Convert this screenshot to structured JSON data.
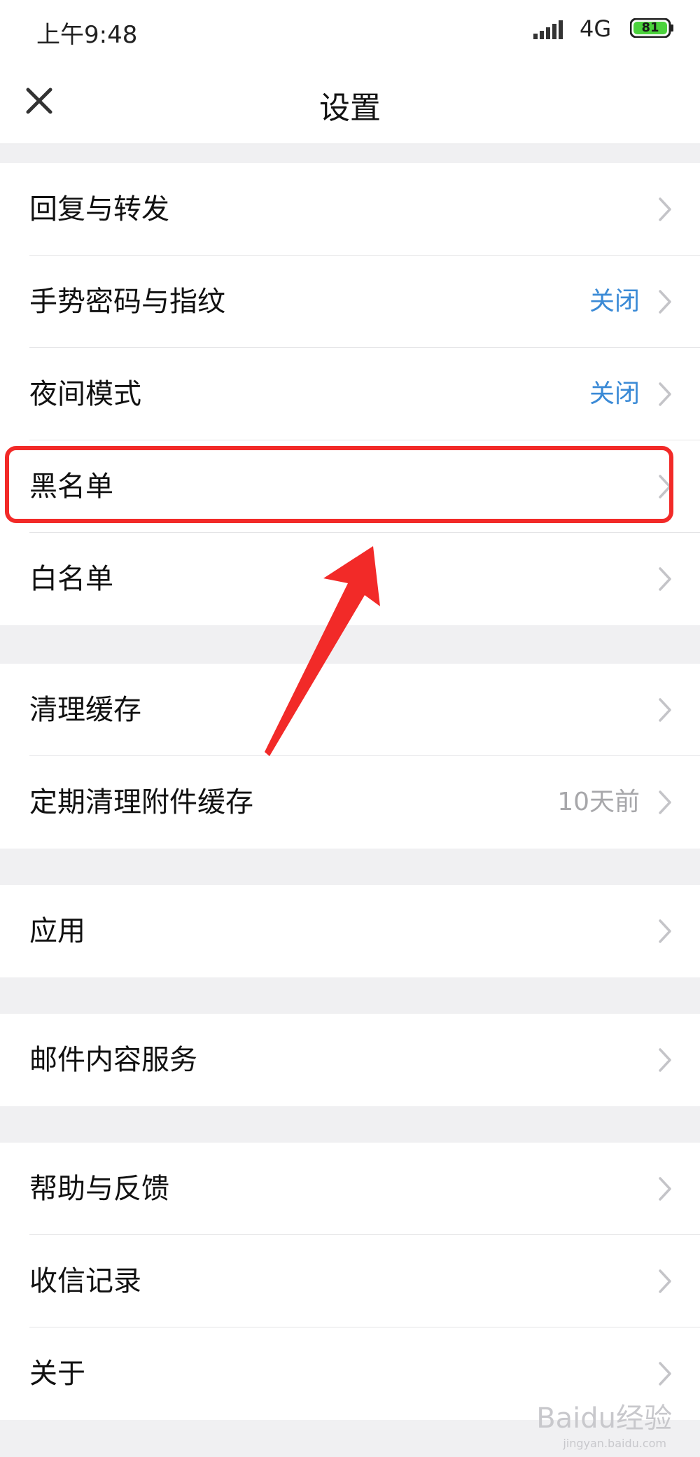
{
  "status_bar": {
    "time": "上午9:48",
    "network": "4G",
    "battery": "81",
    "signal_icon": "signal-bars-icon",
    "battery_icon": "battery-icon"
  },
  "nav": {
    "title": "设置",
    "close_icon": "close-icon"
  },
  "groups": [
    {
      "items": [
        {
          "label": "回复与转发",
          "value": ""
        },
        {
          "label": "手势密码与指纹",
          "value": "关闭"
        },
        {
          "label": "夜间模式",
          "value": "关闭"
        },
        {
          "label": "黑名单",
          "value": ""
        },
        {
          "label": "白名单",
          "value": ""
        }
      ]
    },
    {
      "items": [
        {
          "label": "清理缓存",
          "value": ""
        },
        {
          "label": "定期清理附件缓存",
          "value": "10天前"
        }
      ]
    },
    {
      "items": [
        {
          "label": "应用",
          "value": ""
        }
      ]
    },
    {
      "items": [
        {
          "label": "邮件内容服务",
          "value": ""
        }
      ]
    },
    {
      "items": [
        {
          "label": "帮助与反馈",
          "value": ""
        },
        {
          "label": "收信记录",
          "value": ""
        },
        {
          "label": "关于",
          "value": ""
        }
      ]
    }
  ],
  "watermark": {
    "main": "Baidu经验",
    "sub": "jingyan.baidu.com"
  },
  "colors": {
    "accent_blue": "#3a8ad6",
    "highlight_red": "#f22a28",
    "muted_gray": "#a7a7aa",
    "background": "#f0f0f2"
  }
}
